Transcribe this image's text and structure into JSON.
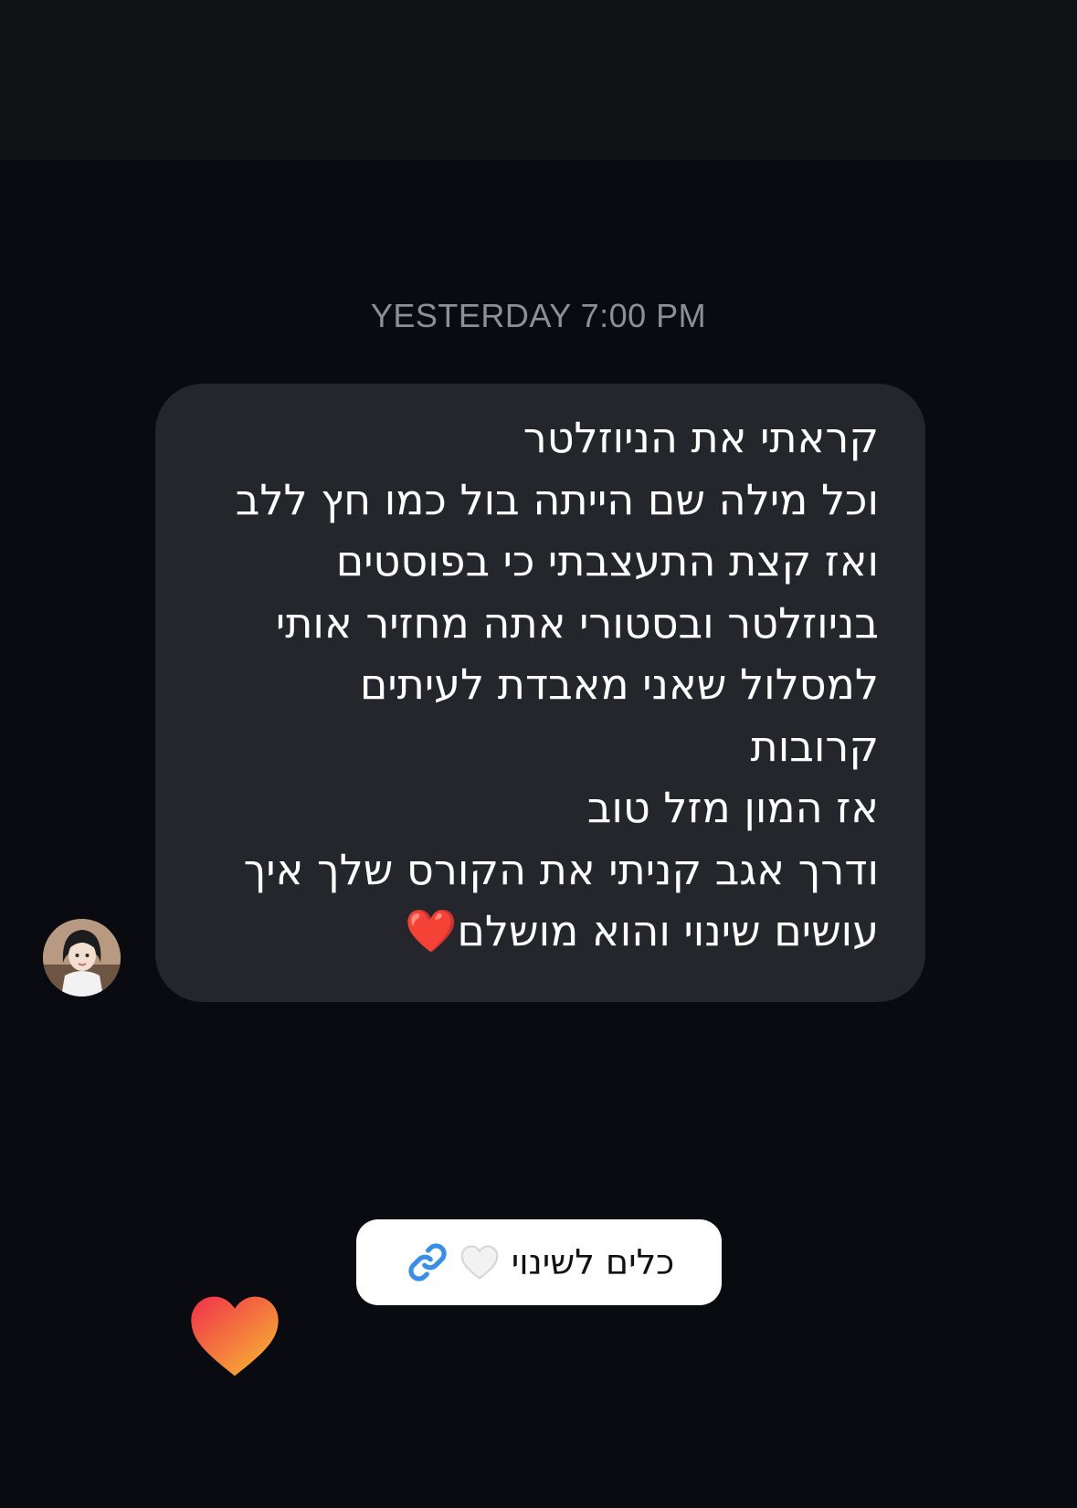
{
  "thread": {
    "timestamp": "YESTERDAY 7:00 PM",
    "message": {
      "lines": [
        "קראתי את הניוזלטר",
        "וכל מילה שם הייתה בול כמו חץ ללב",
        "ואז קצת התעצבתי כי בפוסטים",
        "בניוזלטר ובסטורי אתה מחזיר אותי",
        "למסלול שאני מאבדת לעיתים",
        "קרובות",
        "אז המון מזל טוב",
        "ודרך אגב קניתי את הקורס שלך איך",
        "עושים שינוי והוא מושלם❤️"
      ]
    },
    "sender_avatar_icon": "avatar-woman-icon",
    "link_preview": {
      "label": "כלים לשינוי",
      "heart_icon": "white-heart-icon",
      "link_icon": "link-icon",
      "link_color": "#3a8ee6"
    },
    "reaction_icon": "gradient-heart-icon"
  },
  "colors": {
    "background": "#0a0b10",
    "bubble": "#25262c",
    "timestamp": "#8e8f96",
    "heart_gradient_start": "#f0304a",
    "heart_gradient_end": "#f7b733"
  }
}
